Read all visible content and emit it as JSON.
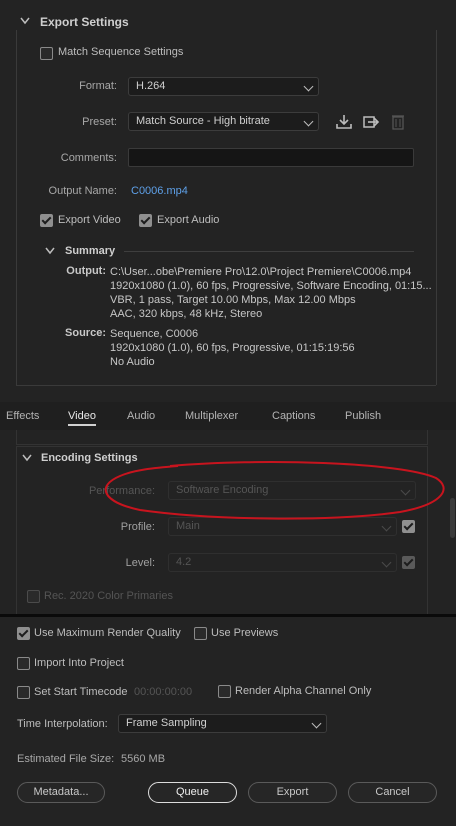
{
  "export_settings": {
    "title": "Export Settings",
    "match_sequence_label": "Match Sequence Settings",
    "format_label": "Format:",
    "format_value": "H.264",
    "preset_label": "Preset:",
    "preset_value": "Match Source - High bitrate",
    "comments_label": "Comments:",
    "comments_value": "",
    "output_name_label": "Output Name:",
    "output_name_value": "C0006.mp4",
    "export_video_label": "Export Video",
    "export_audio_label": "Export Audio",
    "export_video_checked": true,
    "export_audio_checked": true,
    "match_sequence_checked": false
  },
  "summary": {
    "title": "Summary",
    "output_label": "Output:",
    "output_lines": [
      "C:\\User...obe\\Premiere Pro\\12.0\\Project Premiere\\C0006.mp4",
      "1920x1080 (1.0), 60 fps, Progressive, Software Encoding, 01:15...",
      "VBR, 1 pass, Target 10.00 Mbps, Max 12.00 Mbps",
      "AAC, 320 kbps, 48 kHz, Stereo"
    ],
    "source_label": "Source:",
    "source_lines": [
      "Sequence, C0006",
      "1920x1080 (1.0), 60 fps, Progressive, 01:15:19:56",
      "No Audio"
    ]
  },
  "tabs": [
    {
      "label": "Effects",
      "active": false
    },
    {
      "label": "Video",
      "active": true
    },
    {
      "label": "Audio",
      "active": false
    },
    {
      "label": "Multiplexer",
      "active": false
    },
    {
      "label": "Captions",
      "active": false
    },
    {
      "label": "Publish",
      "active": false
    }
  ],
  "encoding": {
    "title": "Encoding Settings",
    "performance_label": "Performance:",
    "performance_value": "Software Encoding",
    "profile_label": "Profile:",
    "profile_value": "Main",
    "level_label": "Level:",
    "level_value": "4.2",
    "rec2020_label": "Rec. 2020 Color Primaries"
  },
  "bottom": {
    "max_render_label": "Use Maximum Render Quality",
    "max_render_checked": true,
    "use_previews_label": "Use Previews",
    "use_previews_checked": false,
    "import_label": "Import Into Project",
    "import_checked": false,
    "start_timecode_label": "Set Start Timecode",
    "start_timecode_checked": false,
    "start_timecode_value": "00:00:00:00",
    "alpha_label": "Render Alpha Channel Only",
    "alpha_checked": false,
    "time_interp_label": "Time Interpolation:",
    "time_interp_value": "Frame Sampling",
    "file_size_label": "Estimated File Size:",
    "file_size_value": "5560 MB",
    "metadata_button": "Metadata...",
    "queue_button": "Queue",
    "export_button": "Export",
    "cancel_button": "Cancel"
  },
  "colors": {
    "background": "#232323",
    "link": "#5ea0e8",
    "annotation_red": "#c8141e"
  }
}
